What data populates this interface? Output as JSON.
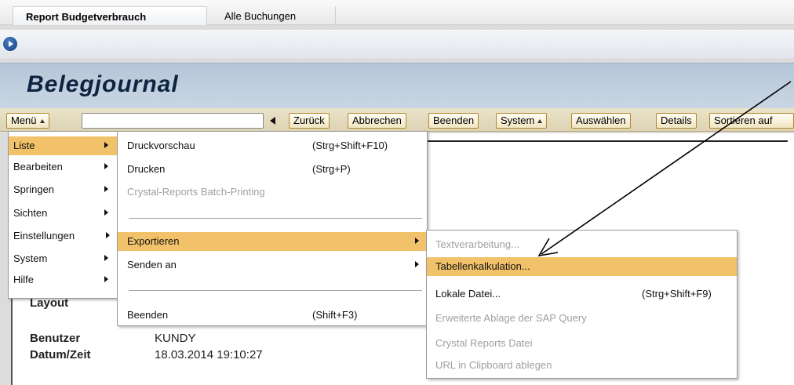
{
  "tabs": [
    {
      "label": "Report Budgetverbrauch"
    },
    {
      "label": "Alle Buchungen"
    }
  ],
  "title": "Belegjournal",
  "toolbar": {
    "menu_label": "Menü",
    "command_field": "",
    "buttons": [
      {
        "label": "Zurück"
      },
      {
        "label": "Abbrechen"
      },
      {
        "label": "Beenden"
      },
      {
        "label": "System"
      },
      {
        "label": "Auswählen"
      },
      {
        "label": "Details"
      },
      {
        "label": "Sortieren auf"
      }
    ]
  },
  "main_menu": {
    "items": [
      {
        "label": "Liste"
      },
      {
        "label": "Bearbeiten"
      },
      {
        "label": "Springen"
      },
      {
        "label": "Sichten"
      },
      {
        "label": "Einstellungen"
      },
      {
        "label": "System"
      },
      {
        "label": "Hilfe"
      }
    ]
  },
  "liste_menu": {
    "items": [
      {
        "label": "Druckvorschau",
        "shortcut": "(Strg+Shift+F10)"
      },
      {
        "label": "Drucken",
        "shortcut": "(Strg+P)"
      },
      {
        "label": "Crystal-Reports Batch-Printing",
        "shortcut": ""
      },
      {
        "label": "Exportieren",
        "shortcut": ""
      },
      {
        "label": "Senden an",
        "shortcut": ""
      },
      {
        "label": "Beenden",
        "shortcut": "(Shift+F3)"
      }
    ]
  },
  "export_menu": {
    "items": [
      {
        "label": "Textverarbeitung...",
        "shortcut": ""
      },
      {
        "label": "Tabellenkalkulation...",
        "shortcut": ""
      },
      {
        "label": "Lokale Datei...",
        "shortcut": "(Strg+Shift+F9)"
      },
      {
        "label": "Erweiterte Ablage der SAP Query",
        "shortcut": ""
      },
      {
        "label": "Crystal Reports Datei",
        "shortcut": ""
      },
      {
        "label": "URL in Clipboard ablegen",
        "shortcut": ""
      }
    ]
  },
  "content": {
    "layout_label": "Layout",
    "benutzer_label": "Benutzer",
    "benutzer_value": "KUNDY",
    "datum_label": "Datum/Zeit",
    "datum_value": "18.03.2014 19:10:27"
  }
}
